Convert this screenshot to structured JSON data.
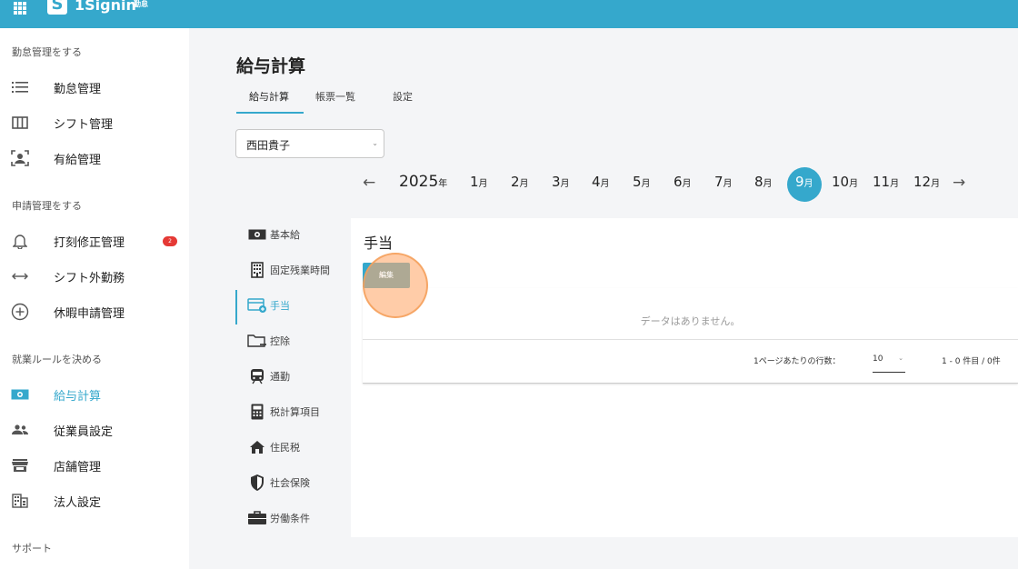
{
  "app": {
    "logo_mark": "S",
    "name": "1Signin",
    "module": "勤怠"
  },
  "sidebar": {
    "sections": [
      {
        "label": "勤怠管理をする"
      },
      {
        "label": "申請管理をする"
      },
      {
        "label": "就業ルールを決める"
      },
      {
        "label": "サポート"
      }
    ],
    "items": [
      {
        "label": "勤怠管理",
        "icon": "list-icon"
      },
      {
        "label": "シフト管理",
        "icon": "columns-icon"
      },
      {
        "label": "有給管理",
        "icon": "person-frame-icon"
      },
      {
        "label": "打刻修正管理",
        "icon": "bell-icon",
        "badge": "2"
      },
      {
        "label": "シフト外勤務",
        "icon": "horizontal-arrows-icon"
      },
      {
        "label": "休暇申請管理",
        "icon": "plus-circle-icon"
      },
      {
        "label": "給与計算",
        "icon": "banknote-icon",
        "active": true
      },
      {
        "label": "従業員設定",
        "icon": "people-icon"
      },
      {
        "label": "店舗管理",
        "icon": "store-icon"
      },
      {
        "label": "法人設定",
        "icon": "building-icon"
      }
    ]
  },
  "header": {
    "title": "給与計算",
    "tabs": [
      {
        "label": "給与計算",
        "active": true
      },
      {
        "label": "帳票一覧"
      },
      {
        "label": "設定"
      }
    ]
  },
  "employee_select": {
    "value": "西田貴子"
  },
  "period": {
    "year": "2025",
    "year_suffix": "年",
    "month_suffix": "月",
    "months": [
      "1",
      "2",
      "3",
      "4",
      "5",
      "6",
      "7",
      "8",
      "9",
      "10",
      "11",
      "12"
    ],
    "selected_month": "9"
  },
  "categories": [
    {
      "label": "基本給",
      "icon": "banknote-icon"
    },
    {
      "label": "固定残業時間",
      "icon": "building-icon"
    },
    {
      "label": "手当",
      "icon": "card-plus-icon",
      "active": true
    },
    {
      "label": "控除",
      "icon": "folder-minus-icon"
    },
    {
      "label": "通勤",
      "icon": "train-icon"
    },
    {
      "label": "税計算項目",
      "icon": "calculator-icon"
    },
    {
      "label": "住民税",
      "icon": "home-icon"
    },
    {
      "label": "社会保険",
      "icon": "shield-icon"
    },
    {
      "label": "労働条件",
      "icon": "briefcase-icon"
    }
  ],
  "panel": {
    "title": "手当",
    "edit_label": "編集",
    "empty_message": "データはありません。",
    "rows_per_page_label": "1ページあたりの行数：",
    "rows_per_page_value": "10",
    "range_text": "1 - 0 件目 / 0件"
  },
  "colors": {
    "accent": "#35a8cc",
    "badge": "#e53935",
    "click_highlight": "#ffaa6e"
  }
}
